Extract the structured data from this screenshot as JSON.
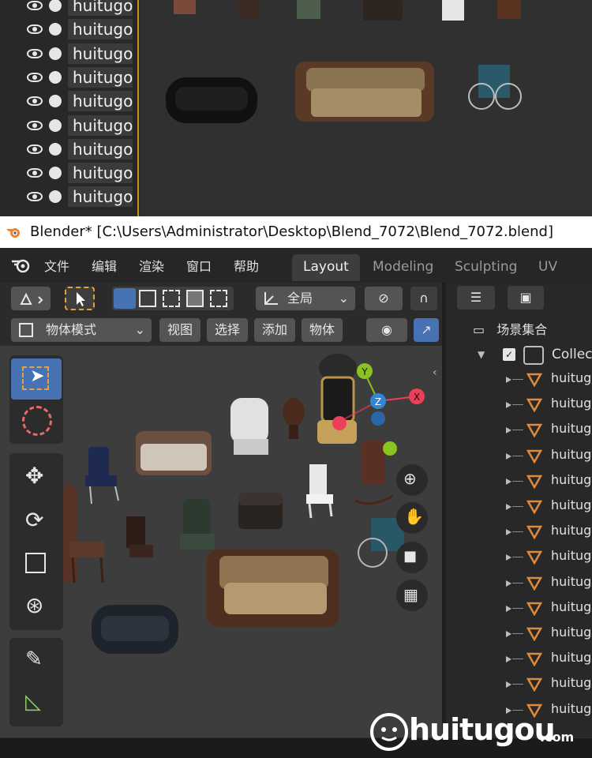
{
  "top_outliner": {
    "items": [
      "huitugou",
      "huitugou",
      "huitugou",
      "huitugou",
      "huitugou",
      "huitugou",
      "huitugou",
      "huitugou",
      "huitugou"
    ]
  },
  "title_bar": {
    "text": "Blender* [C:\\Users\\Administrator\\Desktop\\Blend_7072\\Blend_7072.blend]"
  },
  "menu": {
    "items": [
      "文件",
      "编辑",
      "渲染",
      "窗口",
      "帮助"
    ]
  },
  "workspaces": {
    "tabs": [
      "Layout",
      "Modeling",
      "Sculpting",
      "UV Editi"
    ],
    "active": "Layout"
  },
  "header": {
    "transform_orientation": "全局",
    "mode": "物体模式",
    "view": "视图",
    "select": "选择",
    "add": "添加",
    "object": "物体"
  },
  "gizmo": {
    "axes": [
      "X",
      "Y",
      "Z"
    ],
    "colors": {
      "x": "#ed3f57",
      "y": "#8ac21f",
      "z": "#2f86d8"
    }
  },
  "outliner": {
    "scene_collection": "场景集合",
    "collection": "Collec",
    "items": [
      "huitug",
      "huitug",
      "huitug",
      "huitug",
      "huitug",
      "huitug",
      "huitug",
      "huitug",
      "huitug",
      "huitug",
      "huitug",
      "huitug",
      "huitug",
      "huitug"
    ]
  },
  "watermark": {
    "text": "huitugou",
    "suffix": ".com"
  },
  "colors": {
    "accent": "#4772b3",
    "outline_orange": "#c98f1f",
    "mesh_orange": "#e08a3c"
  }
}
